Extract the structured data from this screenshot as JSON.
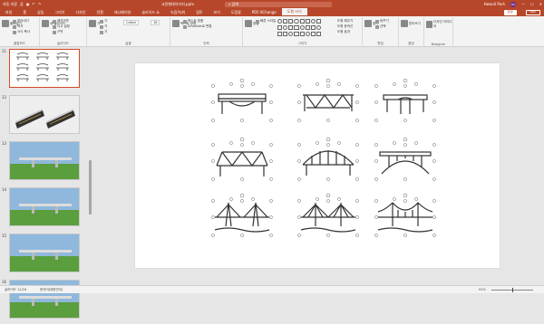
{
  "title_bar": {
    "autosave_label": "자동 저장",
    "autosave_state": "끔",
    "document_name": "교량형태이미지.pptx",
    "search_placeholder": "검색",
    "user_name": "Hwanil Park",
    "user_initials": "HP"
  },
  "tabs": [
    "파일",
    "홈",
    "삽입",
    "그리기",
    "디자인",
    "전환",
    "애니메이션",
    "슬라이드 쇼",
    "녹음/녹화",
    "검토",
    "보기",
    "도움말",
    "PDF-XChange",
    "도형 서식"
  ],
  "active_tab": "도형 서식",
  "share_label": "공유",
  "comments_label": "메모",
  "ribbon": {
    "groups": [
      {
        "label": "클립보드",
        "buttons": [
          "붙여넣기",
          "잘라내기",
          "복사",
          "서식 복사"
        ]
      },
      {
        "label": "슬라이드",
        "buttons": [
          "새 슬라이드",
          "레이아웃",
          "다시 설정",
          "구역"
        ]
      },
      {
        "label": "글꼴",
        "buttons": [
          "가",
          "가",
          "가",
          "가"
        ],
        "font_name": "Calibri",
        "font_size": "18"
      },
      {
        "label": "단락",
        "buttons": [
          "텍스트 방향",
          "텍스트 맞춤",
          "SmartArt로 변환"
        ]
      },
      {
        "label": "그리기",
        "buttons": [
          "정렬",
          "빠른 스타일"
        ]
      },
      {
        "label": "편집",
        "buttons": [
          "찾기",
          "바꾸기",
          "선택"
        ]
      },
      {
        "label": "음성",
        "buttons": [
          "받아쓰기"
        ]
      },
      {
        "label": "Designer",
        "buttons": [
          "디자인 아이디어"
        ]
      }
    ],
    "shape_options": [
      "도형 채우기",
      "도형 윤곽선",
      "도형 효과"
    ]
  },
  "slides": [
    {
      "number": "11",
      "selected": true,
      "kind": "diagram"
    },
    {
      "number": "12",
      "selected": false,
      "kind": "road"
    },
    {
      "number": "13",
      "selected": false,
      "kind": "bridge-scene"
    },
    {
      "number": "14",
      "selected": false,
      "kind": "bridge-scene"
    },
    {
      "number": "15",
      "selected": false,
      "kind": "bridge-scene"
    },
    {
      "number": "16",
      "selected": false,
      "kind": "bridge-scene"
    }
  ],
  "status_bar": {
    "slide_info": "슬라이드 11/16",
    "language": "한국어(대한민국)",
    "zoom": "61%"
  },
  "colors": {
    "accent": "#b7472a",
    "selection": "#d24726",
    "sky": "#8fb8dc",
    "grass": "#5a9e3e"
  }
}
